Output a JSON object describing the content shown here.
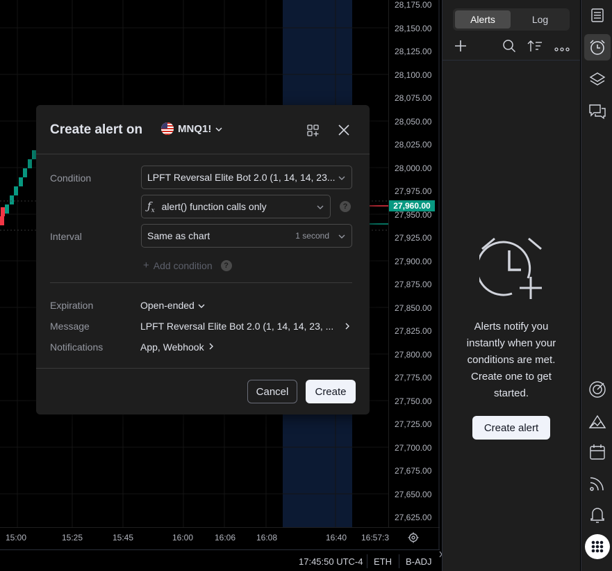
{
  "chart": {
    "price_axis": [
      "28,175.00",
      "28,150.00",
      "28,125.00",
      "28,100.00",
      "28,075.00",
      "28,050.00",
      "28,025.00",
      "28,000.00",
      "27,975.00",
      "27,950.00",
      "27,925.00",
      "27,900.00",
      "27,875.00",
      "27,850.00",
      "27,825.00",
      "27,800.00",
      "27,775.00",
      "27,750.00",
      "27,725.00",
      "27,700.00",
      "27,675.00",
      "27,650.00",
      "27,625.00"
    ],
    "current_price": "27,960.00",
    "time_axis": [
      "15:00",
      "15:25",
      "15:45",
      "16:00",
      "16:06",
      "16:08",
      "16:40",
      "16:57:3"
    ],
    "status": {
      "time": "17:45:50 UTC-4",
      "session": "ETH",
      "adjustment": "B-ADJ"
    },
    "colors": {
      "up": "#089981",
      "down": "#f23645",
      "highlight": "#0c1a33"
    }
  },
  "dialog": {
    "title": "Create alert on",
    "symbol": "MNQ1!",
    "condition_label": "Condition",
    "condition_value": "LPFT Reversal Elite Bot 2.0 (1, 14, 14, 23...",
    "condition_sub_value": "alert() function calls only",
    "interval_label": "Interval",
    "interval_value": "Same as chart",
    "interval_hint": "1 second",
    "add_condition": "Add condition",
    "expiration_label": "Expiration",
    "expiration_value": "Open-ended",
    "message_label": "Message",
    "message_value": "LPFT Reversal Elite Bot 2.0 (1, 14, 14, 23, ...",
    "notifications_label": "Notifications",
    "notifications_value": "App, Webhook",
    "cancel": "Cancel",
    "create": "Create"
  },
  "panel": {
    "tabs": [
      "Alerts",
      "Log"
    ],
    "active_tab": "Alerts",
    "empty_message": "Alerts notify you instantly when your conditions are met. Create one to get started.",
    "create_alert": "Create alert"
  },
  "toolbar": {
    "icons": [
      "watchlist-icon",
      "alert-clock-icon",
      "layers-icon",
      "chat-icon",
      "hotlist-icon",
      "ideas-icon",
      "calendar-icon",
      "news-icon",
      "notifications-icon",
      "apps-icon"
    ]
  }
}
